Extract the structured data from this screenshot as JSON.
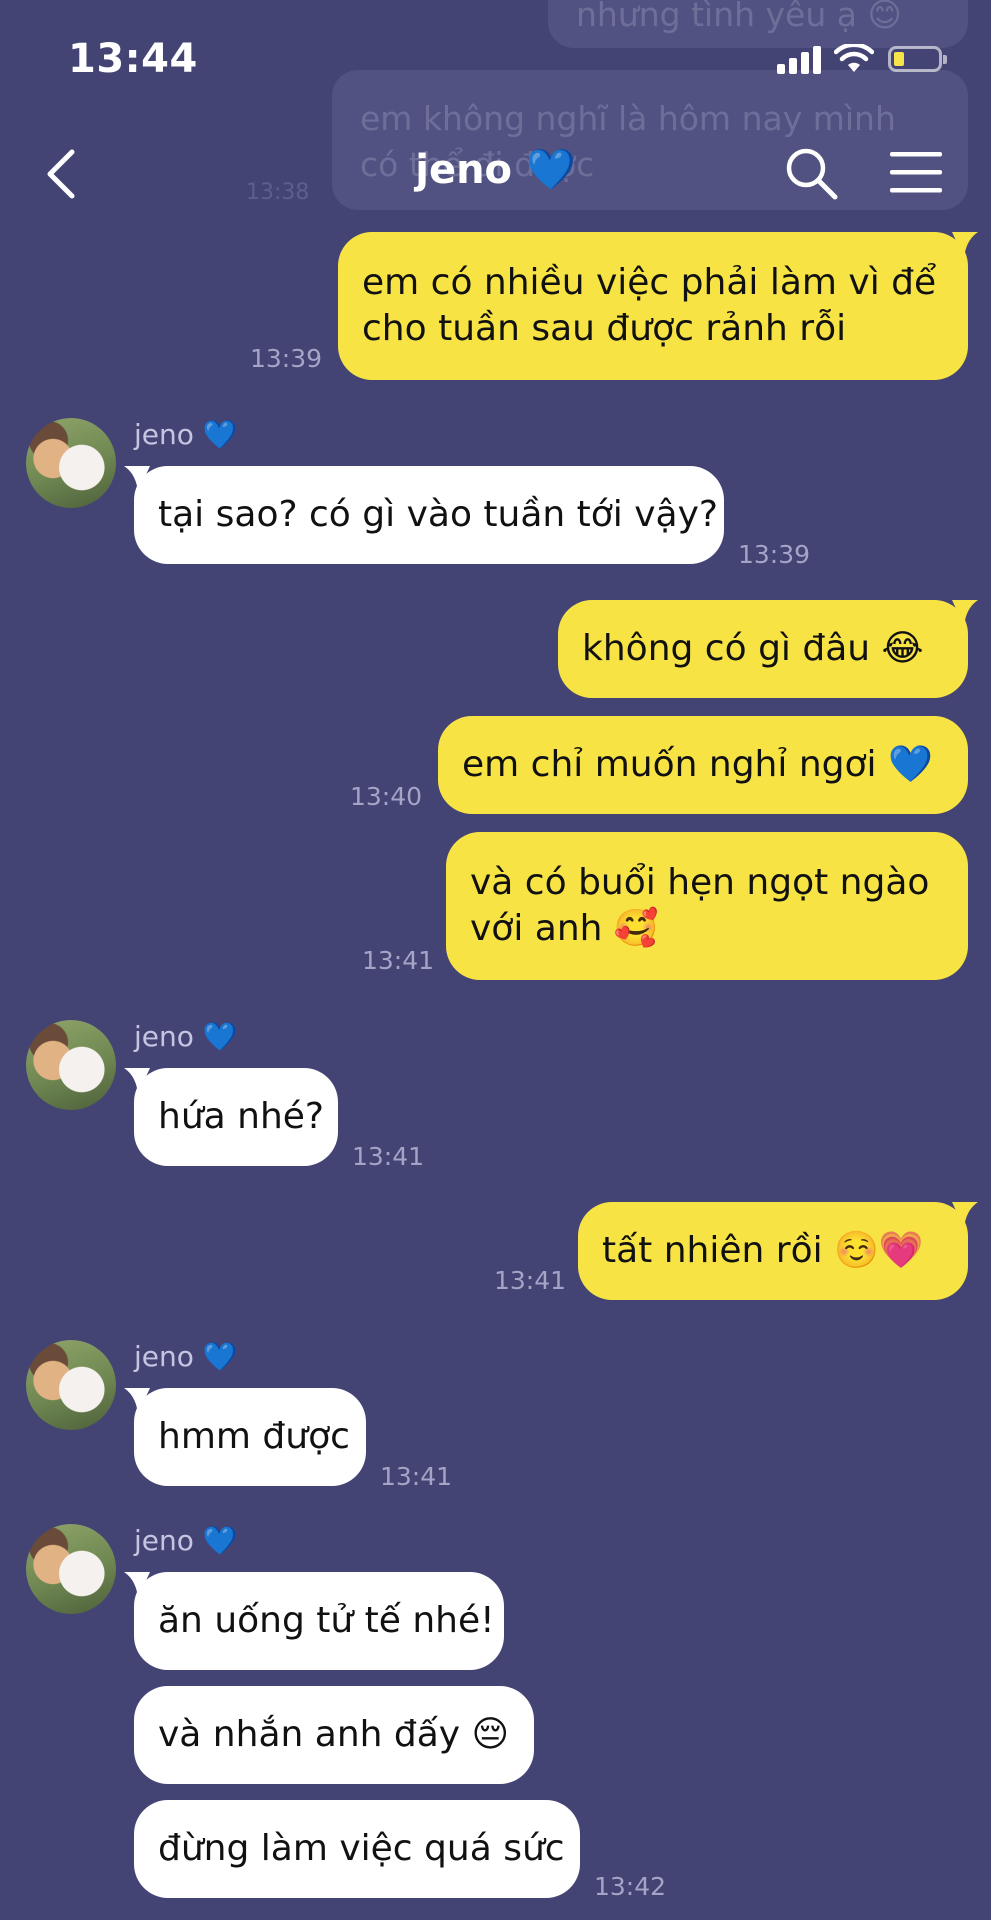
{
  "status_bar": {
    "time": "13:44"
  },
  "background_chat": {
    "line1": "nhưng tình yêu ạ 😊",
    "line2a": "em không nghĩ là hôm nay mình",
    "line2b": "có thể đi được",
    "time": "13:38"
  },
  "header": {
    "title": "jeno 💙"
  },
  "messages": [
    {
      "lines": [
        "em có nhiều việc phải làm vì để",
        "cho tuần sau được rảnh rỗi"
      ],
      "time": "13:39"
    },
    {
      "sender": "jeno 💙",
      "text": "tại sao? có gì vào tuần tới vậy?",
      "time": "13:39"
    },
    {
      "text": "không có gì đâu 😂"
    },
    {
      "text": "em chỉ muốn nghỉ ngơi 💙",
      "time": "13:40"
    },
    {
      "lines": [
        "và có buổi hẹn ngọt ngào",
        "với anh 🥰"
      ],
      "time": "13:41"
    },
    {
      "sender": "jeno 💙",
      "text": "hứa nhé?",
      "time": "13:41"
    },
    {
      "text": "tất nhiên rồi ☺️💗",
      "time": "13:41"
    },
    {
      "sender": "jeno 💙",
      "text": "hmm được",
      "time": "13:41"
    },
    {
      "sender": "jeno 💙",
      "text": "ăn uống tử tế nhé!"
    },
    {
      "text": "và nhắn anh đấy 😔"
    },
    {
      "text": "đừng làm việc quá sức",
      "time": "13:42"
    }
  ]
}
